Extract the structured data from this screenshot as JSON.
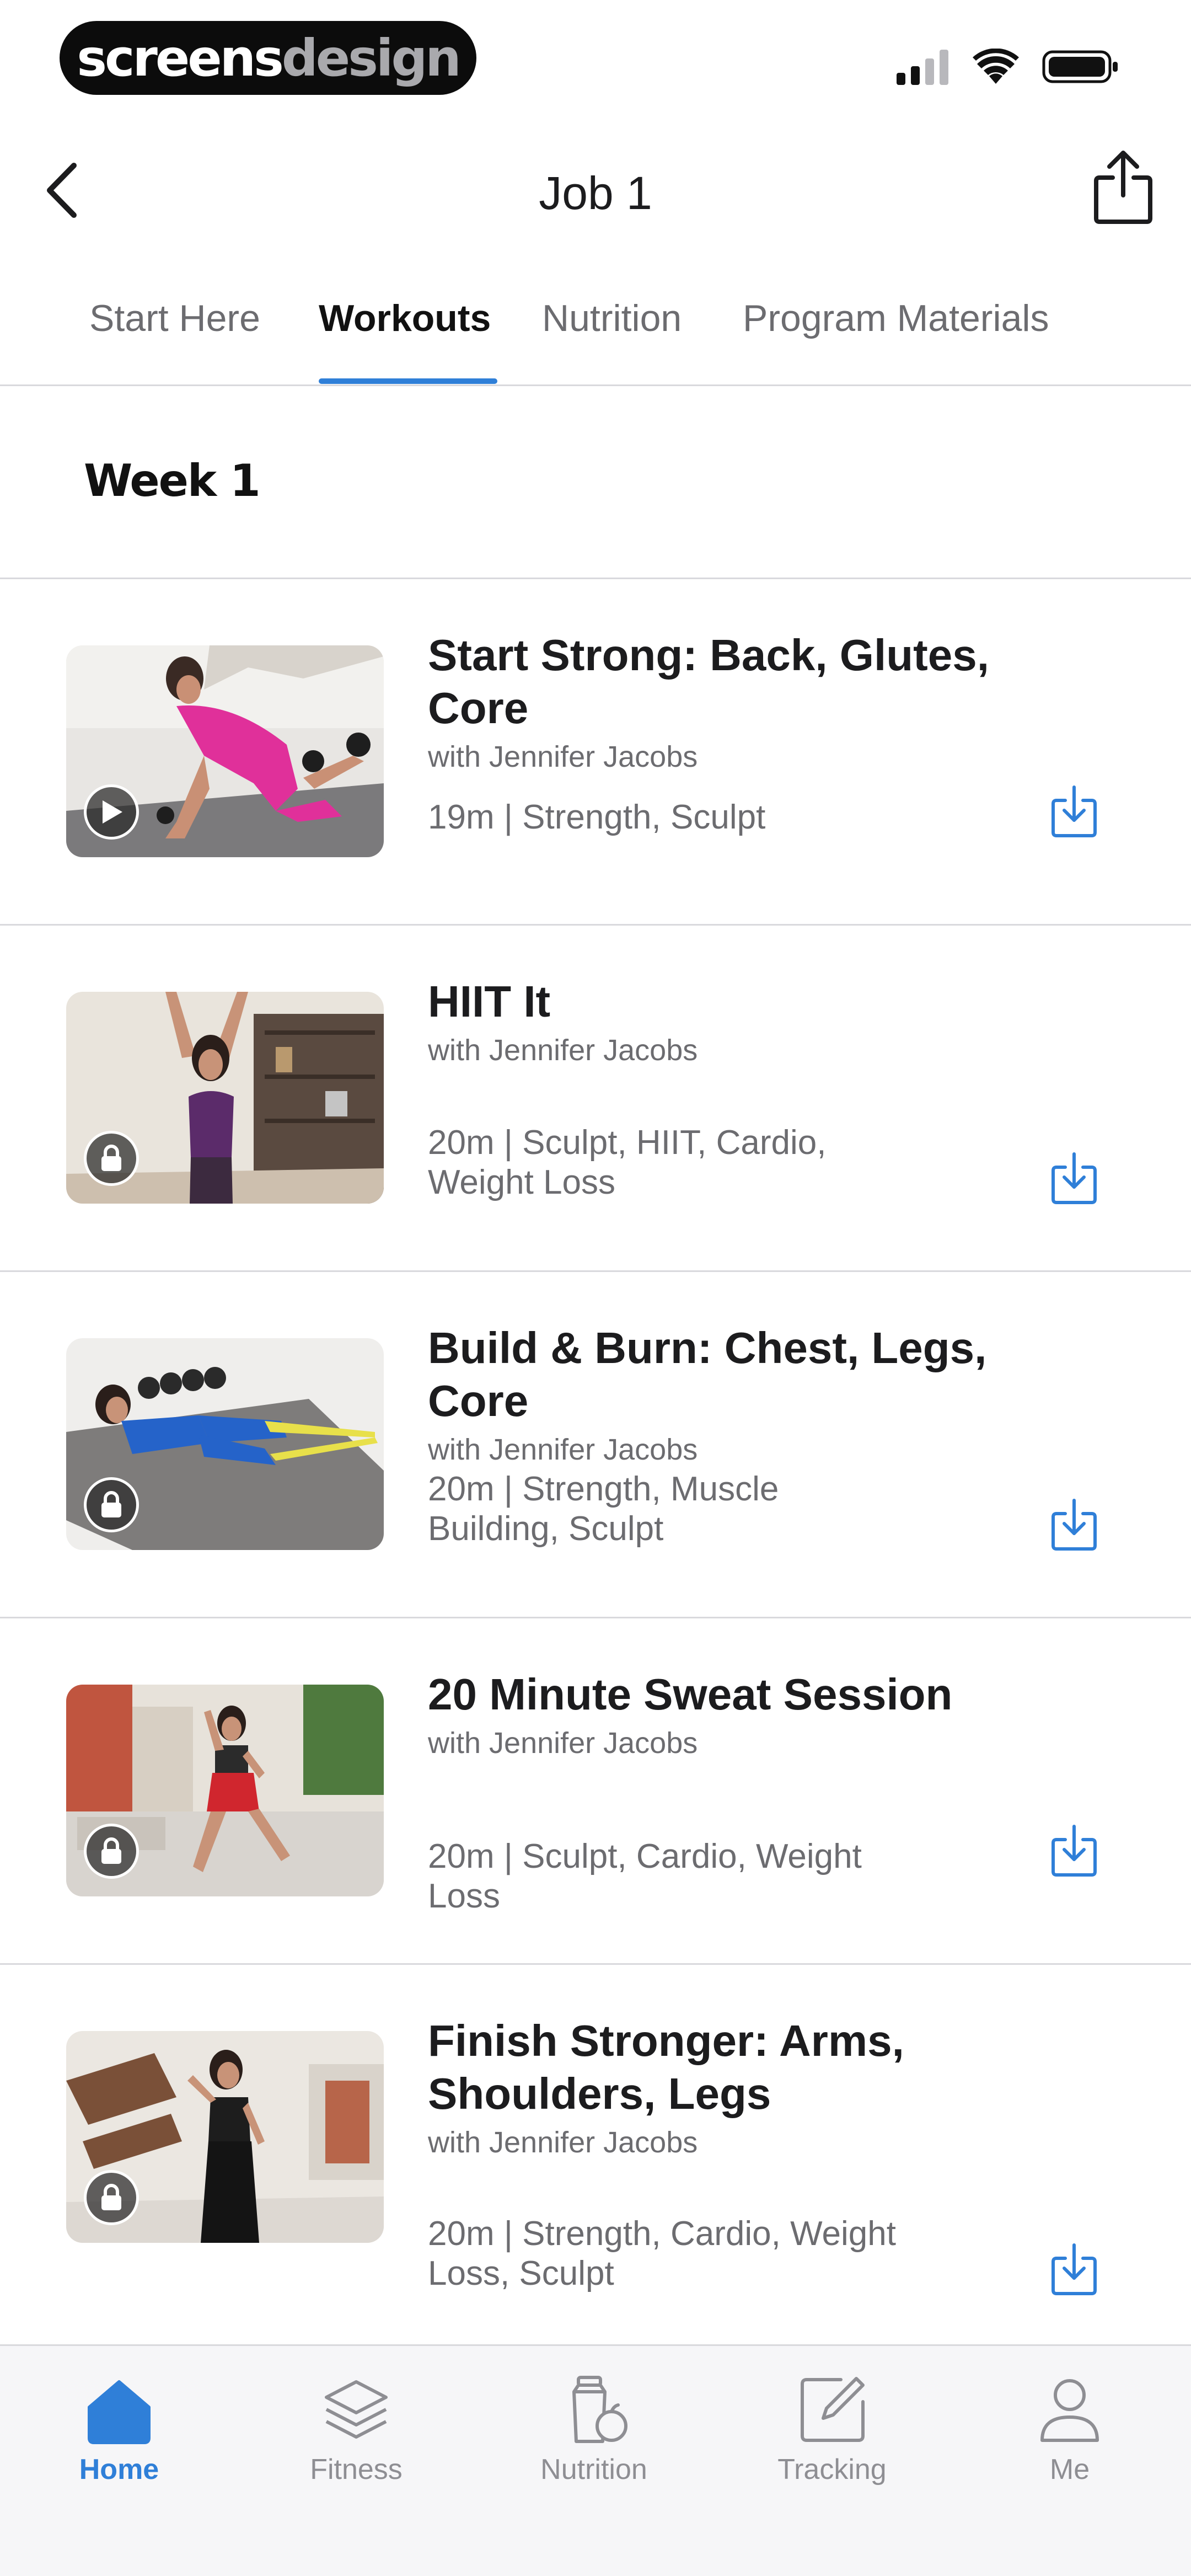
{
  "status_bar": {
    "brand_part1": "screens",
    "brand_part2": "design"
  },
  "nav": {
    "title": "Job 1"
  },
  "tabs": [
    {
      "label": "Start Here"
    },
    {
      "label": "Workouts"
    },
    {
      "label": "Nutrition"
    },
    {
      "label": "Program Materials"
    }
  ],
  "active_tab": "Workouts",
  "week": {
    "title": "Week 1"
  },
  "workouts": [
    {
      "title": "Start Strong: Back, Glutes, Core",
      "coach": "with Jennifer Jacobs",
      "meta_line1": "19m | Strength, Sculpt",
      "meta_line2": "",
      "badge_icon": "play-icon",
      "locked": false
    },
    {
      "title": "HIIT It",
      "coach": "with Jennifer Jacobs",
      "meta_line1": "20m | Sculpt, HIIT, Cardio,",
      "meta_line2": "Weight Loss",
      "badge_icon": "lock-icon",
      "locked": true
    },
    {
      "title": "Build & Burn: Chest, Legs, Core",
      "coach": "with Jennifer Jacobs",
      "meta_line1": "20m | Strength, Muscle",
      "meta_line2": "Building, Sculpt",
      "badge_icon": "lock-icon",
      "locked": true
    },
    {
      "title": "20 Minute Sweat Session",
      "coach": "with Jennifer Jacobs",
      "meta_line1": "20m | Sculpt, Cardio, Weight Loss",
      "meta_line2": "",
      "badge_icon": "lock-icon",
      "locked": true
    },
    {
      "title_line1": "Finish Stronger: Arms,",
      "title_line2": "Shoulders, Legs",
      "coach": "with Jennifer Jacobs",
      "meta_line1": "20m | Strength, Cardio, Weight",
      "meta_line2": "Loss, Sculpt",
      "badge_icon": "lock-icon",
      "locked": true
    }
  ],
  "tab_bar": [
    {
      "label": "Home",
      "icon": "home-icon"
    },
    {
      "label": "Fitness",
      "icon": "layers-icon"
    },
    {
      "label": "Nutrition",
      "icon": "nutrition-icon"
    },
    {
      "label": "Tracking",
      "icon": "edit-icon"
    },
    {
      "label": "Me",
      "icon": "person-icon"
    }
  ],
  "active_tab_bar_item": "Home",
  "colors": {
    "accent": "#2f7fd8",
    "text_primary": "#1c1c1e",
    "text_secondary": "#6c6c70",
    "divider": "#d9d9dd"
  }
}
